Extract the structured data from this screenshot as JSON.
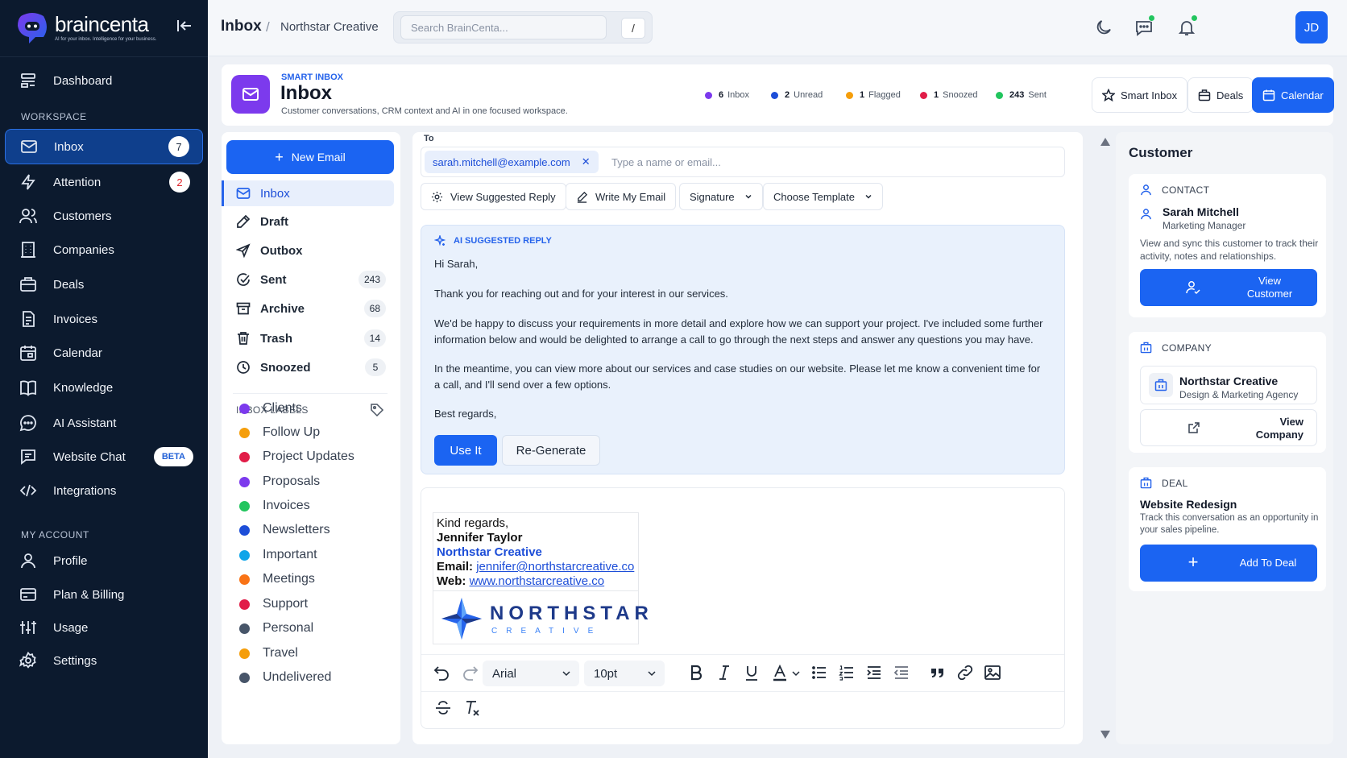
{
  "app": {
    "name": "braincenta",
    "tagline": "AI for your inbox. Intelligence for your business."
  },
  "sidebar": {
    "items": [
      {
        "label": "Dashboard",
        "icon": "dashboard-icon"
      },
      {
        "label": "Inbox",
        "icon": "mail-icon",
        "badge": "7"
      },
      {
        "label": "Attention",
        "icon": "lightning-icon",
        "badge": "2"
      },
      {
        "label": "Customers",
        "icon": "users-icon"
      },
      {
        "label": "Companies",
        "icon": "building-icon"
      },
      {
        "label": "Deals",
        "icon": "briefcase-icon"
      },
      {
        "label": "Invoices",
        "icon": "invoice-icon"
      },
      {
        "label": "Calendar",
        "icon": "calendar-icon"
      },
      {
        "label": "Knowledge",
        "icon": "book-icon"
      },
      {
        "label": "AI Assistant",
        "icon": "chat-bubble-icon"
      },
      {
        "label": "Website Chat",
        "icon": "message-square-icon",
        "badge": "BETA"
      },
      {
        "label": "Integrations",
        "icon": "code-icon"
      }
    ],
    "section_workspace": "WORKSPACE",
    "section_account": "MY ACCOUNT",
    "account_items": [
      {
        "label": "Profile",
        "icon": "user-icon"
      },
      {
        "label": "Plan & Billing",
        "icon": "credit-card-icon"
      },
      {
        "label": "Usage",
        "icon": "sliders-icon"
      },
      {
        "label": "Settings",
        "icon": "gear-icon"
      }
    ]
  },
  "topbar": {
    "crumb_title": "Inbox",
    "crumb_sep": "/",
    "crumb_sub": "Northstar Creative",
    "search_placeholder": "Search BrainCenta...",
    "shortcut": "/",
    "avatar_initials": "JD"
  },
  "header": {
    "eyebrow": "SMART INBOX",
    "title": "Inbox",
    "subtitle": "Customer conversations, CRM context and AI in one focused workspace.",
    "stats": [
      {
        "value": "6",
        "label": "Inbox",
        "color": "#7c3aed"
      },
      {
        "value": "2",
        "label": "Unread",
        "color": "#1d4ed8"
      },
      {
        "value": "1",
        "label": "Flagged",
        "color": "#f59e0b"
      },
      {
        "value": "1",
        "label": "Snoozed",
        "color": "#e11d48"
      },
      {
        "value": "243",
        "label": "Sent",
        "color": "#22c55e"
      }
    ],
    "buttons": {
      "smart_inbox": "Smart Inbox",
      "deals": "Deals",
      "calendar": "Calendar"
    }
  },
  "folders": {
    "new_email": "New Email",
    "items": [
      {
        "label": "Inbox",
        "icon": "inbox-icon",
        "count": ""
      },
      {
        "label": "Draft",
        "icon": "pencil-icon",
        "count": ""
      },
      {
        "label": "Outbox",
        "icon": "send-icon",
        "count": ""
      },
      {
        "label": "Sent",
        "icon": "check-circle-icon",
        "count": "243"
      },
      {
        "label": "Archive",
        "icon": "archive-icon",
        "count": "68"
      },
      {
        "label": "Trash",
        "icon": "trash-icon",
        "count": "14"
      },
      {
        "label": "Snoozed",
        "icon": "clock-icon",
        "count": "5"
      }
    ],
    "labels_heading": "INBOX LABELS",
    "labels": [
      {
        "label": "Clients",
        "color": "#7c3aed"
      },
      {
        "label": "Follow Up",
        "color": "#f59e0b"
      },
      {
        "label": "Project Updates",
        "color": "#e11d48"
      },
      {
        "label": "Proposals",
        "color": "#7c3aed"
      },
      {
        "label": "Invoices",
        "color": "#22c55e"
      },
      {
        "label": "Newsletters",
        "color": "#1d4ed8"
      },
      {
        "label": "Important",
        "color": "#0ea5e9"
      },
      {
        "label": "Meetings",
        "color": "#f97316"
      },
      {
        "label": "Support",
        "color": "#e11d48"
      },
      {
        "label": "Personal",
        "color": "#475569"
      },
      {
        "label": "Travel",
        "color": "#f59e0b"
      },
      {
        "label": "Undelivered",
        "color": "#475569"
      }
    ]
  },
  "compose": {
    "to_label": "To",
    "recipient": "sarah.mitchell@example.com",
    "to_placeholder": "Type a name or email...",
    "buttons": {
      "suggested": "View Suggested Reply",
      "write": "Write My Email",
      "signature": "Signature",
      "template": "Choose Template"
    },
    "ai": {
      "heading": "AI SUGGESTED REPLY",
      "p1": "Hi Sarah,",
      "p2": "Thank you for reaching out and for your interest in our services.",
      "p3": "We'd be happy to discuss your requirements in more detail and explore how we can support your project. I've included some further information below and would be delighted to arrange a call to go through the next steps and answer any questions you may have.",
      "p4": "In the meantime, you can view more about our services and case studies on our website. Please let me know a convenient time for a call, and I'll send over a few options.",
      "p5": "Best regards,",
      "use_it": "Use It",
      "regenerate": "Re-Generate"
    },
    "signature": {
      "closing": "Kind regards,",
      "name": "Jennifer Taylor",
      "company": "Northstar Creative",
      "email_label": "Email:",
      "email": "jennifer@northstarcreative.co",
      "web_label": "Web:",
      "web": "www.northstarcreative.co",
      "logo_word": "NORTHSTAR",
      "logo_sub": "CREATIVE"
    },
    "toolbar": {
      "font": "Arial",
      "size": "10pt"
    }
  },
  "customer": {
    "title": "Customer",
    "contact_heading": "CONTACT",
    "contact_name": "Sarah Mitchell",
    "contact_role": "Marketing Manager",
    "contact_text": "View and sync this customer to track their activity, notes and relationships.",
    "view_customer": "View Customer",
    "company_heading": "COMPANY",
    "company_name": "Northstar Creative",
    "company_type": "Design & Marketing Agency",
    "view_company": "View Company",
    "deal_heading": "DEAL",
    "deal_name": "Website Redesign",
    "deal_text": "Track this conversation as an opportunity in your sales pipeline.",
    "add_deal": "Add To Deal"
  }
}
